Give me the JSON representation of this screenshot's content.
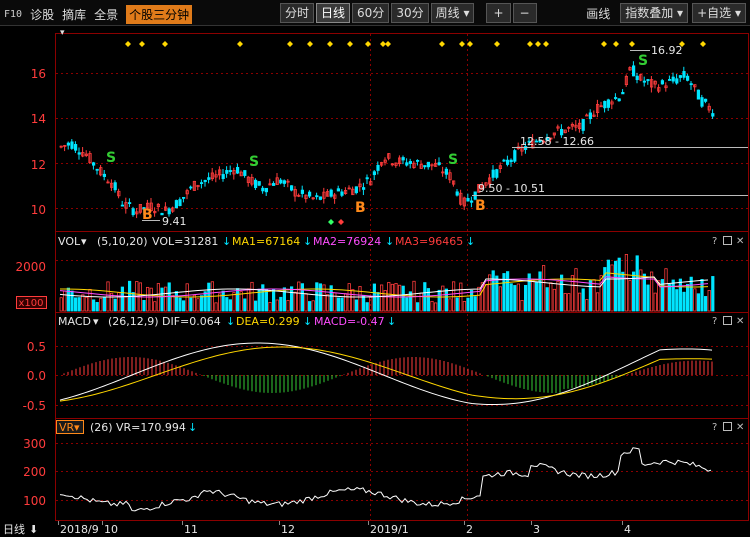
{
  "toolbar": {
    "f10": "F10",
    "left_items": [
      "诊股",
      "摘库",
      "全景"
    ],
    "active_item": "个股三分钟",
    "periods": [
      "分时",
      "日线",
      "60分",
      "30分",
      "周线"
    ],
    "selected_period": "日线",
    "plus": "+",
    "minus": "−",
    "right_items": [
      "画线",
      "指数叠加",
      "+自选"
    ]
  },
  "main_panel": {
    "y_ticks": [
      "16",
      "14",
      "12",
      "10"
    ],
    "annotations": {
      "high": "16.92",
      "low": "9.41",
      "zone1": "12.58 - 12.66",
      "zone2": "9.50 - 10.51"
    },
    "signals": [
      "S",
      "S",
      "S",
      "S",
      "B",
      "B",
      "B"
    ]
  },
  "vol_panel": {
    "name": "VOL",
    "params": "(5,10,20)",
    "vol": "VOL=31281",
    "ma1": "MA1=67164",
    "ma2": "MA2=76924",
    "ma3": "MA3=96465",
    "y_tick": "2000",
    "unit": "x100"
  },
  "macd_panel": {
    "name": "MACD",
    "params": "(26,12,9)",
    "dif": "DIF=0.064",
    "dea": "DEA=0.299",
    "macd": "MACD=-0.47",
    "y_ticks": [
      "0.5",
      "0.0",
      "-0.5"
    ]
  },
  "vr_panel": {
    "name": "VR",
    "params": "(26)",
    "vr": "VR=170.994",
    "y_ticks": [
      "300",
      "200",
      "100"
    ]
  },
  "x_axis": {
    "period_label": "日线",
    "labels": [
      "2018/9",
      "10",
      "11",
      "12",
      "2019/1",
      "2",
      "3",
      "4"
    ]
  },
  "colors": {
    "up": "#ff3c3c",
    "down": "#00e5ff",
    "grid": "#8b0000",
    "yellow": "#ffd700",
    "magenta": "#ff4dff",
    "white": "#ffffff",
    "green": "#33cc33",
    "orange": "#ff8a1a"
  }
}
